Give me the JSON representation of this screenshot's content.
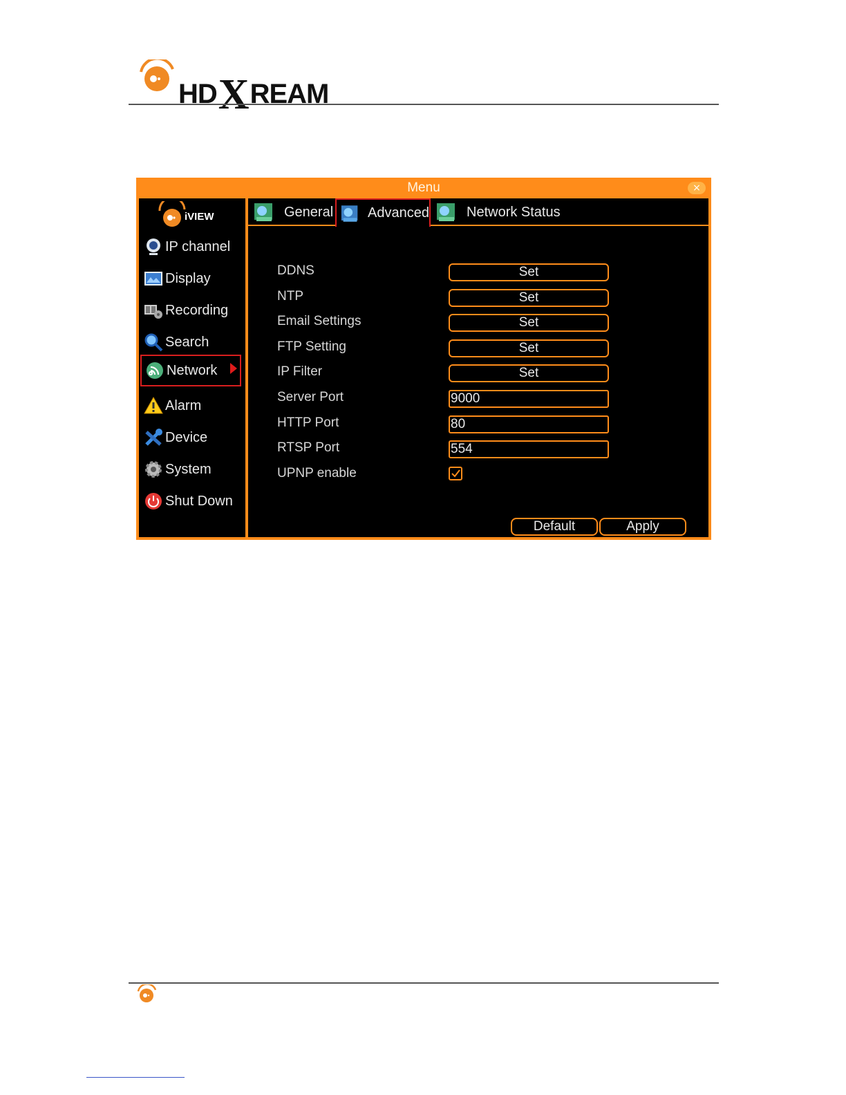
{
  "brand": {
    "prefix": "HD",
    "x": "X",
    "suffix": "REAM"
  },
  "window": {
    "title": "Menu",
    "close_glyph": "×"
  },
  "sidebar": {
    "logo_text": "iVIEW",
    "items": [
      {
        "label": "IP channel",
        "icon": "camera-icon"
      },
      {
        "label": "Display",
        "icon": "display-icon"
      },
      {
        "label": "Recording",
        "icon": "recording-icon"
      },
      {
        "label": "Search",
        "icon": "search-icon"
      },
      {
        "label": "Network",
        "icon": "network-icon",
        "active": true
      },
      {
        "label": "Alarm",
        "icon": "alarm-icon"
      },
      {
        "label": "Device",
        "icon": "device-icon"
      },
      {
        "label": "System",
        "icon": "system-gear-icon"
      },
      {
        "label": "Shut Down",
        "icon": "power-icon"
      }
    ]
  },
  "tabs": [
    {
      "label": "General",
      "active": false
    },
    {
      "label": "Advanced",
      "active": true
    },
    {
      "label": "Network Status",
      "active": false
    }
  ],
  "settings": {
    "ddns": {
      "label": "DDNS",
      "button": "Set"
    },
    "ntp": {
      "label": "NTP",
      "button": "Set"
    },
    "email": {
      "label": "Email Settings",
      "button": "Set"
    },
    "ftp": {
      "label": "FTP Setting",
      "button": "Set"
    },
    "ipfilter": {
      "label": "IP Filter",
      "button": "Set"
    },
    "server_port": {
      "label": "Server Port",
      "value": "9000"
    },
    "http_port": {
      "label": "HTTP Port",
      "value": "80"
    },
    "rtsp_port": {
      "label": "RTSP Port",
      "value": "554"
    },
    "upnp": {
      "label": "UPNP enable",
      "checked": true
    }
  },
  "buttons": {
    "default": "Default",
    "apply": "Apply"
  },
  "colors": {
    "accent": "#ff8c1a",
    "active_border": "#d81e1e",
    "panel_bg": "#000000"
  }
}
